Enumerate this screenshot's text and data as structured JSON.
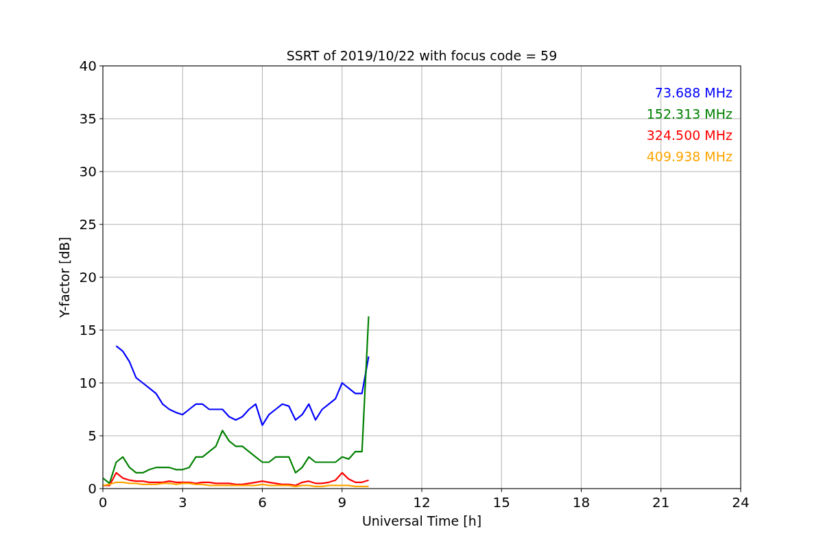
{
  "figure": {
    "chart_data": {
      "type": "line",
      "title": "SSRT of 2019/10/22 with focus code = 59",
      "xlabel": "Universal Time [h]",
      "ylabel": "Y-factor [dB]",
      "x": [
        0,
        0.25,
        0.5,
        0.75,
        1,
        1.25,
        1.5,
        1.75,
        2,
        2.25,
        2.5,
        2.75,
        3,
        3.25,
        3.5,
        3.75,
        4,
        4.25,
        4.5,
        4.75,
        5,
        5.25,
        5.5,
        5.75,
        6,
        6.25,
        6.5,
        6.75,
        7,
        7.25,
        7.5,
        7.75,
        8,
        8.25,
        8.5,
        8.75,
        9,
        9.25,
        9.5,
        9.75,
        10
      ],
      "series": [
        {
          "name": "73.688 MHz",
          "color": "#0000ff",
          "values": [
            null,
            null,
            13.5,
            13,
            12,
            10.5,
            10,
            9.5,
            9,
            8,
            7.5,
            7.2,
            7,
            7.5,
            8,
            8,
            7.5,
            7.5,
            7.5,
            6.8,
            6.5,
            6.8,
            7.5,
            8,
            6,
            7,
            7.5,
            8,
            7.8,
            6.5,
            7,
            8,
            6.5,
            7.5,
            8,
            8.5,
            10,
            9.5,
            9,
            9,
            12.5
          ]
        },
        {
          "name": "152.313 MHz",
          "color": "#008000",
          "values": [
            1,
            0.5,
            2.5,
            3,
            2,
            1.5,
            1.5,
            1.8,
            2,
            2,
            2,
            1.8,
            1.8,
            2,
            3,
            3,
            3.5,
            4,
            5.5,
            4.5,
            4,
            4,
            3.5,
            3,
            2.5,
            2.5,
            3,
            3,
            3,
            1.5,
            2,
            3,
            2.5,
            2.5,
            2.5,
            2.5,
            3,
            2.8,
            3.5,
            3.5,
            16.3
          ]
        },
        {
          "name": "324.500 MHz",
          "color": "#ff0000",
          "values": [
            0.3,
            0.3,
            1.5,
            1,
            0.8,
            0.7,
            0.7,
            0.6,
            0.6,
            0.6,
            0.7,
            0.6,
            0.6,
            0.6,
            0.5,
            0.6,
            0.6,
            0.5,
            0.5,
            0.5,
            0.4,
            0.4,
            0.5,
            0.6,
            0.7,
            0.6,
            0.5,
            0.4,
            0.4,
            0.3,
            0.6,
            0.7,
            0.5,
            0.5,
            0.6,
            0.8,
            1.5,
            0.9,
            0.6,
            0.6,
            0.8
          ]
        },
        {
          "name": "409.938 MHz",
          "color": "#ffa500",
          "values": [
            0.3,
            0.4,
            0.6,
            0.6,
            0.5,
            0.5,
            0.4,
            0.4,
            0.4,
            0.5,
            0.5,
            0.4,
            0.5,
            0.5,
            0.4,
            0.4,
            0.3,
            0.3,
            0.3,
            0.3,
            0.3,
            0.3,
            0.3,
            0.3,
            0.4,
            0.3,
            0.3,
            0.3,
            0.3,
            0.2,
            0.3,
            0.3,
            0.2,
            0.2,
            0.3,
            0.3,
            0.3,
            0.3,
            0.2,
            0.2,
            0.2
          ]
        }
      ],
      "xlim": [
        0,
        24
      ],
      "ylim": [
        0,
        40
      ],
      "xticks": [
        0,
        3,
        6,
        9,
        12,
        15,
        18,
        21,
        24
      ],
      "yticks": [
        0,
        5,
        10,
        15,
        20,
        25,
        30,
        35,
        40
      ],
      "grid": true
    }
  }
}
